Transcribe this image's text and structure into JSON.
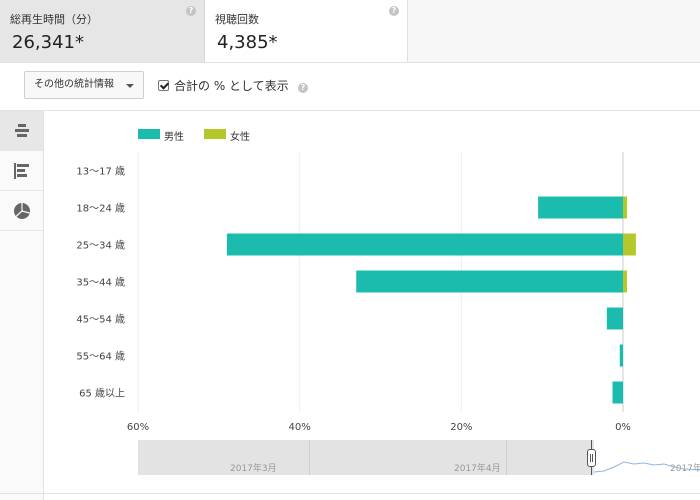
{
  "metrics": [
    {
      "label": "総再生時間（分）",
      "value": "26,341*"
    },
    {
      "label": "視聴回数",
      "value": "4,385*"
    }
  ],
  "toolbar": {
    "more_stats_label": "その他の統計情報",
    "percent_checkbox_label": "合計の % として表示",
    "percent_checked": true
  },
  "sidebar": {
    "items": [
      {
        "icon": "bar-diverging-icon",
        "active": true
      },
      {
        "icon": "bar-horizontal-icon",
        "active": false
      },
      {
        "icon": "pie-chart-icon",
        "active": false
      }
    ]
  },
  "chart_data": {
    "type": "bar",
    "orientation": "horizontal-diverging",
    "categories": [
      "13〜17 歳",
      "18〜24 歳",
      "25〜34 歳",
      "35〜44 歳",
      "45〜54 歳",
      "55〜64 歳",
      "65 歳以上"
    ],
    "series": [
      {
        "name": "男性",
        "color": "#1bbcad",
        "values": [
          0,
          10.5,
          49,
          33,
          2,
          0.4,
          1.3
        ]
      },
      {
        "name": "女性",
        "color": "#b5c82b",
        "values": [
          0,
          0.5,
          1.6,
          0.5,
          0,
          0,
          0
        ]
      }
    ],
    "xticks": [
      "60%",
      "40%",
      "20%",
      "0%"
    ],
    "xlim": [
      60,
      0
    ],
    "legend": "top-left",
    "grid": true
  },
  "timeline": {
    "labels": [
      "2017年3月",
      "2017年4月",
      "2017年"
    ]
  },
  "colors": {
    "male": "#1bbcad",
    "female": "#b5c82b",
    "help": "#c4c4c4"
  }
}
